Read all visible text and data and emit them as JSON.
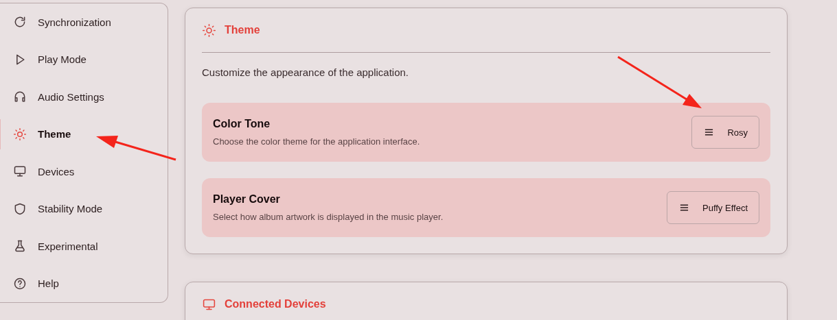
{
  "sidebar": {
    "items": [
      {
        "label": "Synchronization",
        "kind": "sync",
        "selected": false
      },
      {
        "label": "Play Mode",
        "kind": "play",
        "selected": false
      },
      {
        "label": "Audio Settings",
        "kind": "headphones",
        "selected": false
      },
      {
        "label": "Theme",
        "kind": "sun",
        "selected": true
      },
      {
        "label": "Devices",
        "kind": "monitor",
        "selected": false
      },
      {
        "label": "Stability Mode",
        "kind": "shield",
        "selected": false
      },
      {
        "label": "Experimental",
        "kind": "flask",
        "selected": false
      },
      {
        "label": "Help",
        "kind": "help",
        "selected": false
      }
    ]
  },
  "sections": [
    {
      "title": "Theme",
      "kind": "sun",
      "description": "Customize the appearance of the application.",
      "settings": [
        {
          "title": "Color Tone",
          "description": "Choose the color theme for the application interface.",
          "value": "Rosy"
        },
        {
          "title": "Player Cover",
          "description": "Select how album artwork is displayed in the music player.",
          "value": "Puffy Effect"
        }
      ]
    },
    {
      "title": "Connected Devices",
      "kind": "monitor"
    }
  ]
}
